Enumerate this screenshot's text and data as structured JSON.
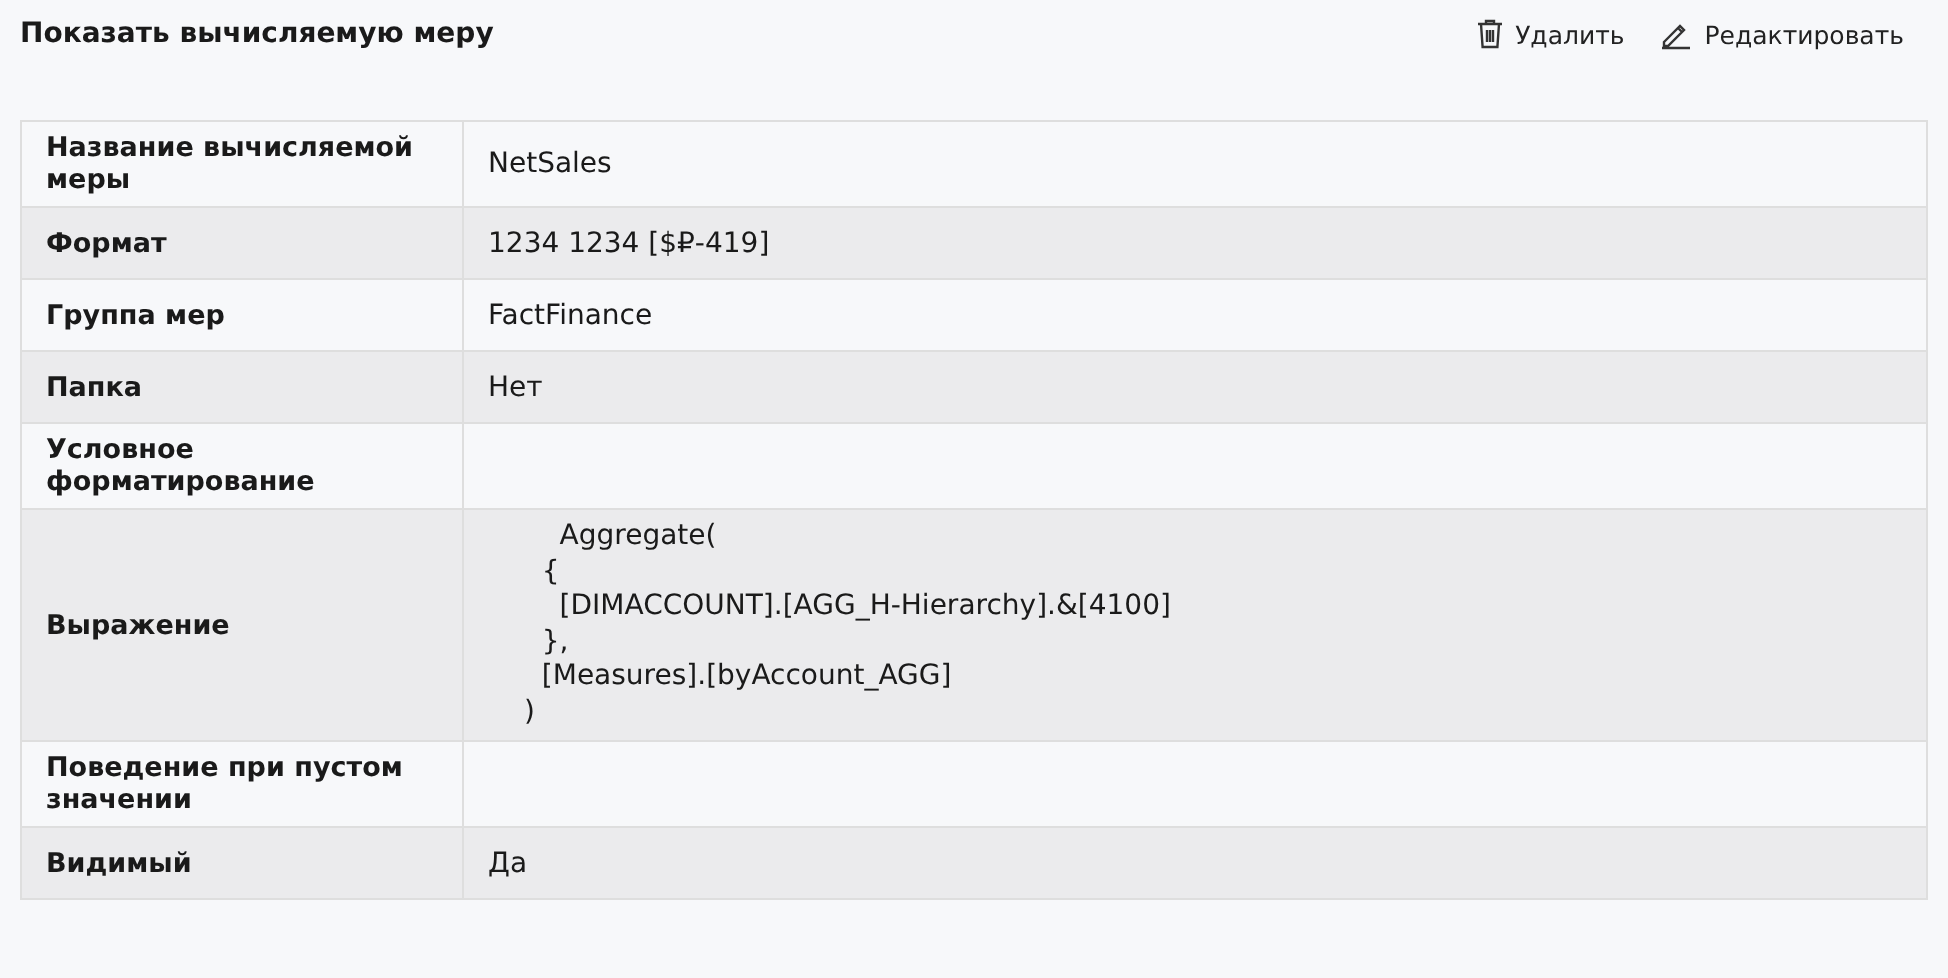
{
  "title": "Показать вычисляемую меру",
  "actions": [
    {
      "kind": "delete",
      "label": "Удалить"
    },
    {
      "kind": "edit",
      "label": "Редактировать"
    }
  ],
  "rows": [
    {
      "label": "Название вычисляемой меры",
      "value": "NetSales"
    },
    {
      "label": "Формат",
      "value": "1234 1234 [$₽-419]"
    },
    {
      "label": "Группа мер",
      "value": "FactFinance"
    },
    {
      "label": "Папка",
      "value": "Нет"
    },
    {
      "label": "Условное форматирование"
    },
    {
      "label": "Выражение",
      "code_lines": [
        "    Aggregate(",
        "  {",
        "    [DIMACCOUNT].[AGG_H-Hierarchy].&[4100]",
        "  },",
        "  [Measures].[byAccount_AGG]",
        ")"
      ]
    },
    {
      "label": "Поведение при пустом значении"
    },
    {
      "label": "Видимый",
      "value": "Да"
    }
  ]
}
